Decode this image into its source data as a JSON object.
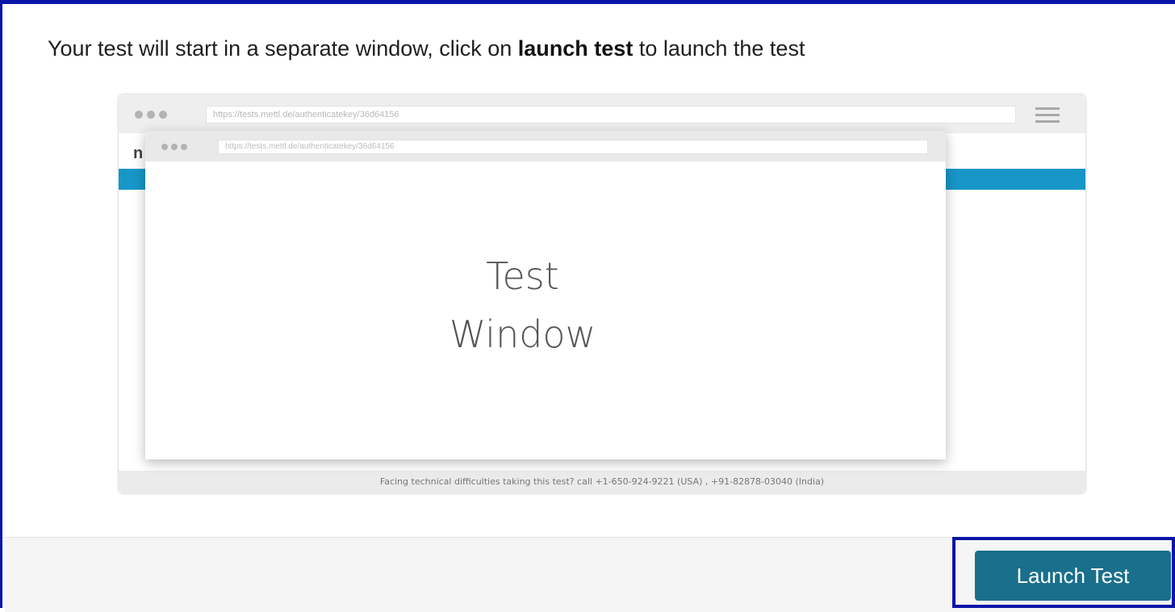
{
  "instruction": {
    "prefix": "Your test will start in a separate window, click on ",
    "emphasis": "launch test",
    "suffix": " to launch the test"
  },
  "illustration": {
    "outer_url": "https://tests.mettl.de/authenticatekey/36d64156",
    "outer_partial_text": "n",
    "inner_url": "https://tests.mettl.de/authenticatekey/36d64156",
    "window_label_line1": "Test",
    "window_label_line2": "Window",
    "footer_text": "Facing technical difficulties taking this test? call +1-650-924-9221 (USA) , +91-82878-03040 (India)"
  },
  "actions": {
    "launch_label": "Launch Test"
  },
  "colors": {
    "highlight_border": "#0a14a8",
    "button_bg": "#1a6f8c",
    "band_blue": "#1796c8"
  }
}
